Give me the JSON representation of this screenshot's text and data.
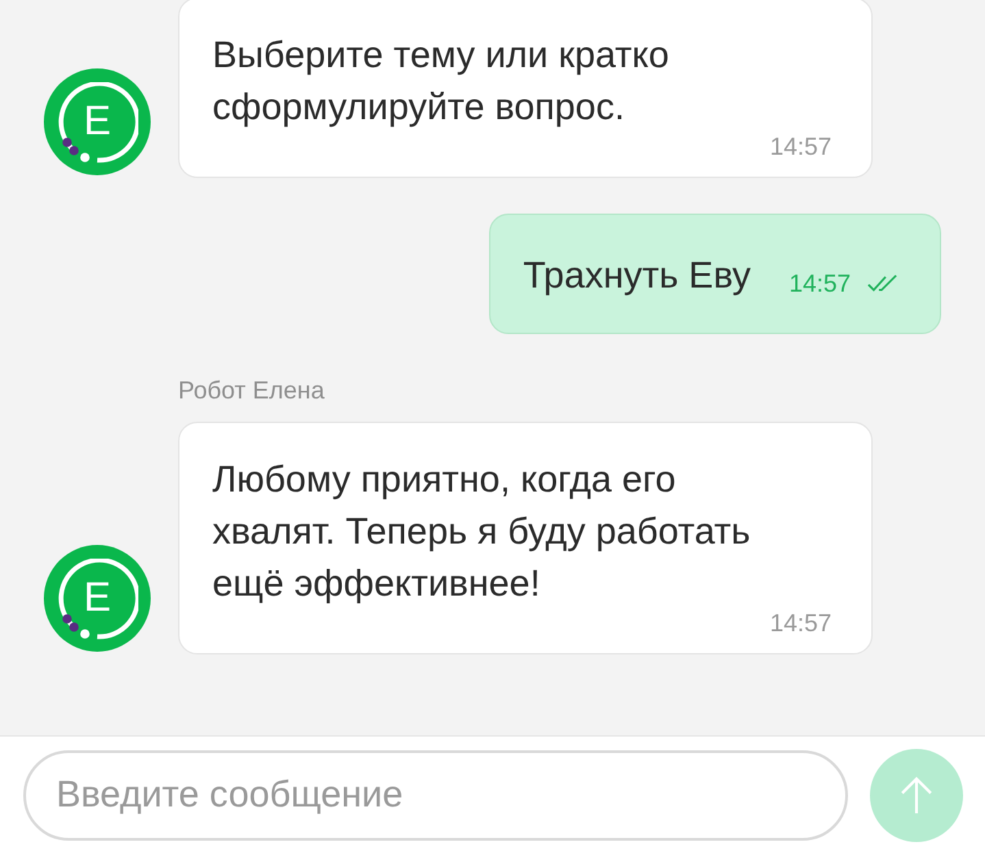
{
  "messages": [
    {
      "kind": "bot",
      "avatar": "E",
      "text": "Выберите тему или кратко сформулируйте вопрос.",
      "time": "14:57"
    },
    {
      "kind": "user",
      "text": "Трахнуть Еву",
      "time": "14:57",
      "read": true
    },
    {
      "kind": "bot",
      "sender": "Робот Елена",
      "avatar": "E",
      "text": "Любому приятно, когда его хвалят. Теперь я буду работать ещё эффективнее!",
      "time": "14:57"
    }
  ],
  "composer": {
    "placeholder": "Введите сообщение",
    "send_disabled": true
  }
}
